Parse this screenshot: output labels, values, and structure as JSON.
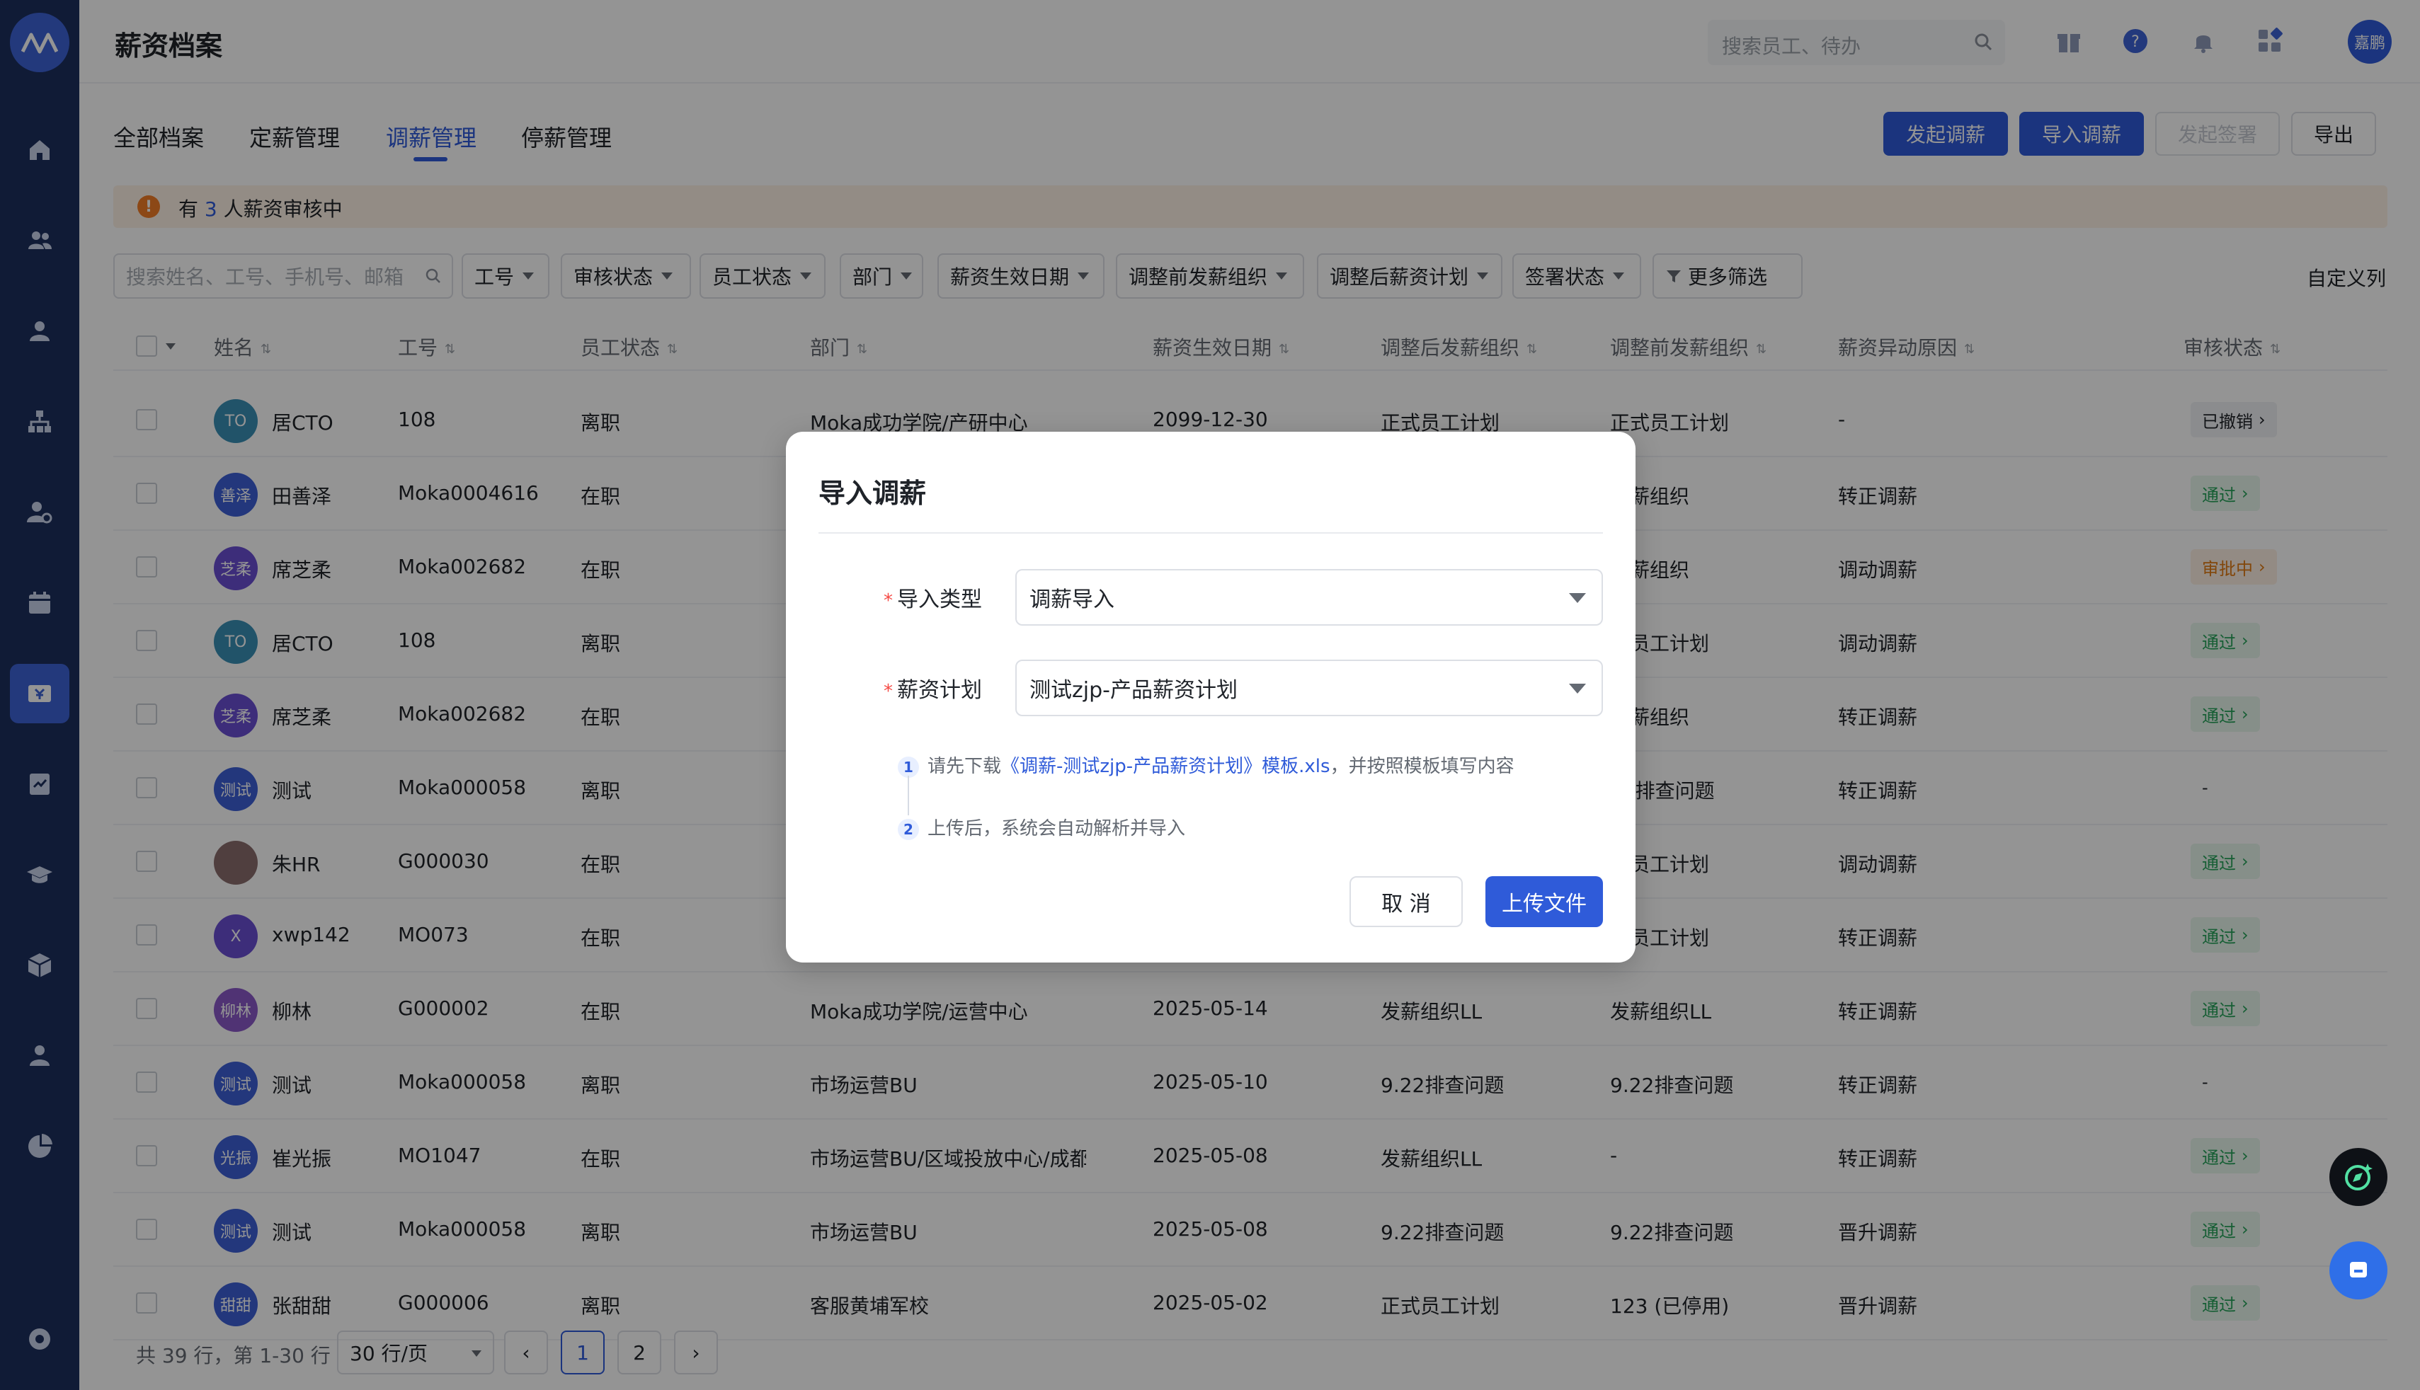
{
  "header": {
    "title": "薪资档案",
    "search_placeholder": "搜索员工、待办",
    "avatar_text": "嘉鹏"
  },
  "sidebar": {
    "icons": [
      "home-icon",
      "team-icon",
      "person-icon",
      "org-chart-icon",
      "person-settings-icon",
      "calendar-icon",
      "payroll-icon",
      "task-icon",
      "education-icon",
      "cube-icon",
      "profile-icon",
      "pie-chart-icon",
      "settings-icon"
    ],
    "active": "payroll-icon"
  },
  "tabs": [
    "全部档案",
    "定薪管理",
    "调薪管理",
    "停薪管理"
  ],
  "active_tab": "调薪管理",
  "actions": {
    "start_adjust": "发起调薪",
    "import_adjust": "导入调薪",
    "start_sign": "发起签署",
    "export": "导出"
  },
  "notice": {
    "prefix": "有",
    "count": "3",
    "suffix": "人薪资审核中"
  },
  "filters": {
    "search_placeholder": "搜索姓名、工号、手机号、邮箱",
    "items": [
      "工号",
      "审核状态",
      "员工状态",
      "部门",
      "薪资生效日期",
      "调整前发薪组织",
      "调整后薪资计划",
      "签署状态"
    ],
    "more": "更多筛选",
    "custom_columns": "自定义列"
  },
  "table": {
    "headers": [
      "姓名",
      "工号",
      "员工状态",
      "部门",
      "薪资生效日期",
      "调整后发薪组织",
      "调整前发薪组织",
      "薪资异动原因",
      "审核状态"
    ],
    "rows": [
      {
        "avatar": "TO",
        "name": "居CTO",
        "id": "108",
        "emp_status": "离职",
        "dept": "Moka成功学院/产研中心",
        "date": "2099-12-30",
        "after_org": "正式员工计划",
        "before_org": "正式员工计划",
        "reason": "-",
        "status": "已撤销",
        "status_type": "revoked"
      },
      {
        "avatar": "善泽",
        "name": "田善泽",
        "id": "Moka0004616",
        "emp_status": "在职",
        "dept": "",
        "date": "",
        "after_org": "",
        "before_org": "发薪组织",
        "reason": "转正调薪",
        "status": "通过",
        "status_type": "pass"
      },
      {
        "avatar": "芝柔",
        "name": "席芝柔",
        "id": "Moka002682",
        "emp_status": "在职",
        "dept": "",
        "date": "",
        "after_org": "",
        "before_org": "发薪组织",
        "reason": "调动调薪",
        "status": "审批中",
        "status_type": "pending"
      },
      {
        "avatar": "TO",
        "name": "居CTO",
        "id": "108",
        "emp_status": "离职",
        "dept": "",
        "date": "",
        "after_org": "",
        "before_org": "式员工计划",
        "reason": "调动调薪",
        "status": "通过",
        "status_type": "pass"
      },
      {
        "avatar": "芝柔",
        "name": "席芝柔",
        "id": "Moka002682",
        "emp_status": "在职",
        "dept": "",
        "date": "",
        "after_org": "",
        "before_org": "发薪组织",
        "reason": "转正调薪",
        "status": "通过",
        "status_type": "pass"
      },
      {
        "avatar": "测试",
        "name": "测试",
        "id": "Moka000058",
        "emp_status": "离职",
        "dept": "",
        "date": "",
        "after_org": "",
        "before_org": "22排查问题",
        "reason": "转正调薪",
        "status": "-",
        "status_type": "none"
      },
      {
        "avatar": "",
        "name": "朱HR",
        "id": "G000030",
        "emp_status": "在职",
        "dept": "",
        "date": "",
        "after_org": "",
        "before_org": "式员工计划",
        "reason": "调动调薪",
        "status": "通过",
        "status_type": "pass"
      },
      {
        "avatar": "X",
        "name": "xwp142",
        "id": "MO073",
        "emp_status": "在职",
        "dept": "",
        "date": "",
        "after_org": "",
        "before_org": "式员工计划",
        "reason": "转正调薪",
        "status": "通过",
        "status_type": "pass"
      },
      {
        "avatar": "柳林",
        "name": "柳林",
        "id": "G000002",
        "emp_status": "在职",
        "dept": "Moka成功学院/运营中心",
        "date": "2025-05-14",
        "after_org": "发薪组织LL",
        "before_org": "发薪组织LL",
        "reason": "转正调薪",
        "status": "通过",
        "status_type": "pass"
      },
      {
        "avatar": "测试",
        "name": "测试",
        "id": "Moka000058",
        "emp_status": "离职",
        "dept": "市场运营BU",
        "date": "2025-05-10",
        "after_org": "9.22排查问题",
        "before_org": "9.22排查问题",
        "reason": "转正调薪",
        "status": "-",
        "status_type": "none"
      },
      {
        "avatar": "光振",
        "name": "崔光振",
        "id": "MO1047",
        "emp_status": "在职",
        "dept": "市场运营BU/区域投放中心/成都...",
        "date": "2025-05-08",
        "after_org": "发薪组织LL",
        "before_org": "-",
        "reason": "转正调薪",
        "status": "通过",
        "status_type": "pass"
      },
      {
        "avatar": "测试",
        "name": "测试",
        "id": "Moka000058",
        "emp_status": "离职",
        "dept": "市场运营BU",
        "date": "2025-05-08",
        "after_org": "9.22排查问题",
        "before_org": "9.22排查问题",
        "reason": "晋升调薪",
        "status": "通过",
        "status_type": "pass"
      },
      {
        "avatar": "甜甜",
        "name": "张甜甜",
        "id": "G000006",
        "emp_status": "离职",
        "dept": "客服黄埔军校",
        "date": "2025-05-02",
        "after_org": "正式员工计划",
        "before_org": "123 (已停用)",
        "reason": "晋升调薪",
        "status": "通过",
        "status_type": "pass"
      }
    ]
  },
  "pagination": {
    "summary": "共 39 行，第 1-30 行",
    "page_size": "30 行/页",
    "prev": "‹",
    "next": "›",
    "pages": [
      "1",
      "2"
    ],
    "current": "1"
  },
  "modal": {
    "title": "导入调薪",
    "import_type_label": "导入类型",
    "import_type_value": "调薪导入",
    "plan_label": "薪资计划",
    "plan_value": "测试zjp-产品薪资计划",
    "step1_num": "1",
    "step1_prefix": "请先下载",
    "step1_link": "《调薪-测试zjp-产品薪资计划》模板.xls",
    "step1_suffix": "，并按照模板填写内容",
    "step2_num": "2",
    "step2_text": "上传后，系统会自动解析并导入",
    "cancel": "取 消",
    "upload": "上传文件"
  },
  "colors": {
    "primary": "#2f5bd9",
    "sidebar": "#1d2f5e",
    "pass": "#26a35a",
    "pending": "#e07a14"
  }
}
